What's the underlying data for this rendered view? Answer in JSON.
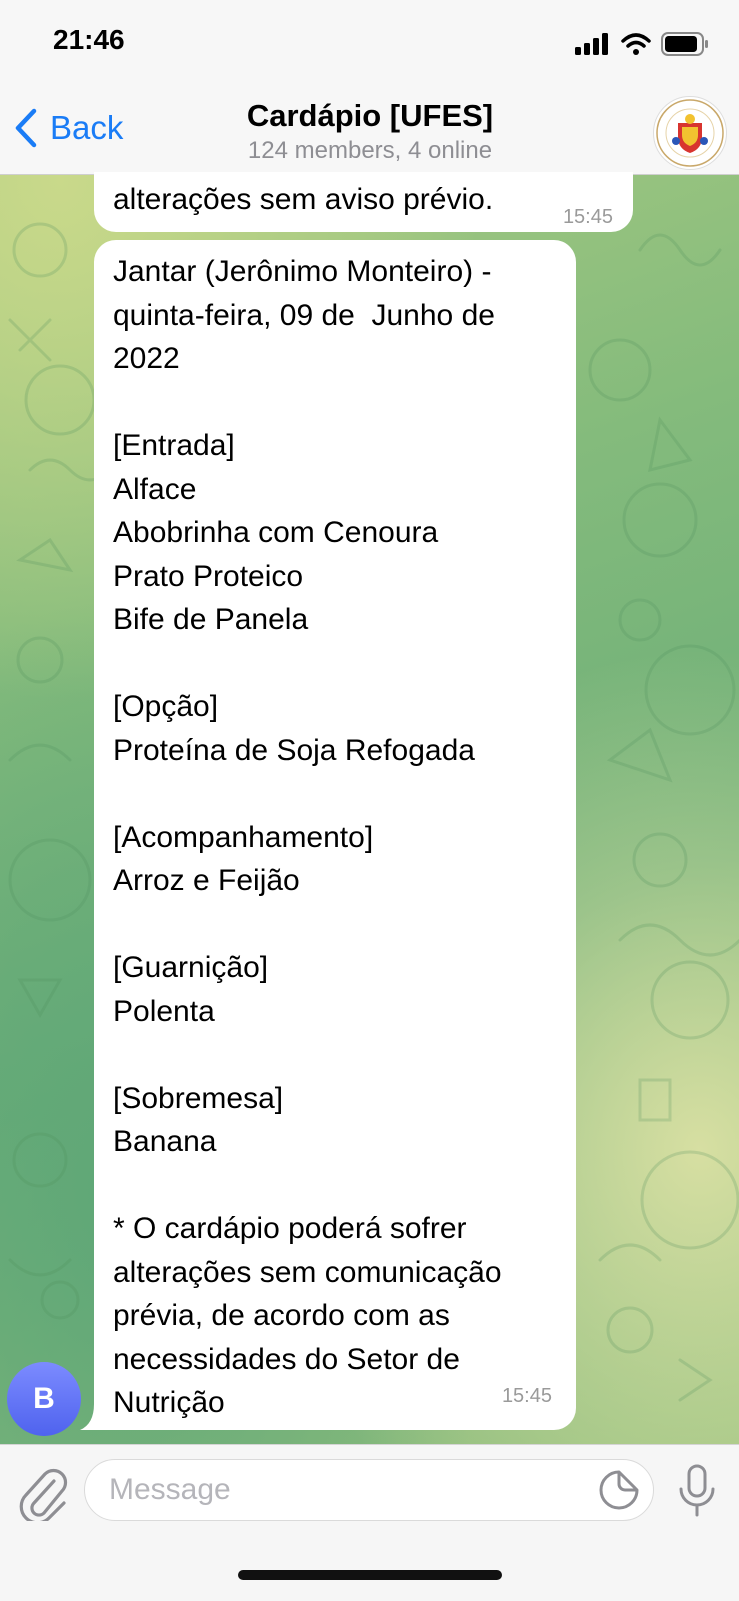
{
  "status_bar": {
    "time": "21:46"
  },
  "header": {
    "back_label": "Back",
    "title": "Cardápio [UFES]",
    "subtitle": "124 members, 4 online"
  },
  "messages": [
    {
      "lines": [
        "alterações sem aviso prévio."
      ],
      "time": "15:45"
    },
    {
      "lines": [
        "Jantar (Jerônimo Monteiro) -",
        "quinta-feira, 09 de  Junho de",
        "2022",
        "",
        "[Entrada]",
        "Alface",
        "Abobrinha com Cenoura",
        "Prato Proteico",
        "Bife de Panela",
        "",
        "[Opção]",
        "Proteína de Soja Refogada",
        "",
        "[Acompanhamento]",
        "Arroz e Feijão",
        "",
        "[Guarnição]",
        "Polenta",
        "",
        "[Sobremesa]",
        "Banana",
        "",
        "* O cardápio poderá sofrer",
        "alterações sem comunicação",
        "prévia, de acordo com as",
        "necessidades do Setor de",
        "Nutrição"
      ],
      "time": "15:45",
      "sender_initial": "B"
    }
  ],
  "input": {
    "placeholder": "Message"
  },
  "icons": {
    "back": "chevron-left-icon",
    "attach": "paperclip-icon",
    "sticker": "sticker-icon",
    "mic": "microphone-icon",
    "signal": "cellular-signal-icon",
    "wifi": "wifi-icon",
    "battery": "battery-icon"
  },
  "colors": {
    "accent": "#1a7cf6",
    "bubble": "#ffffff",
    "sender_avatar": "#5b6cf2"
  }
}
